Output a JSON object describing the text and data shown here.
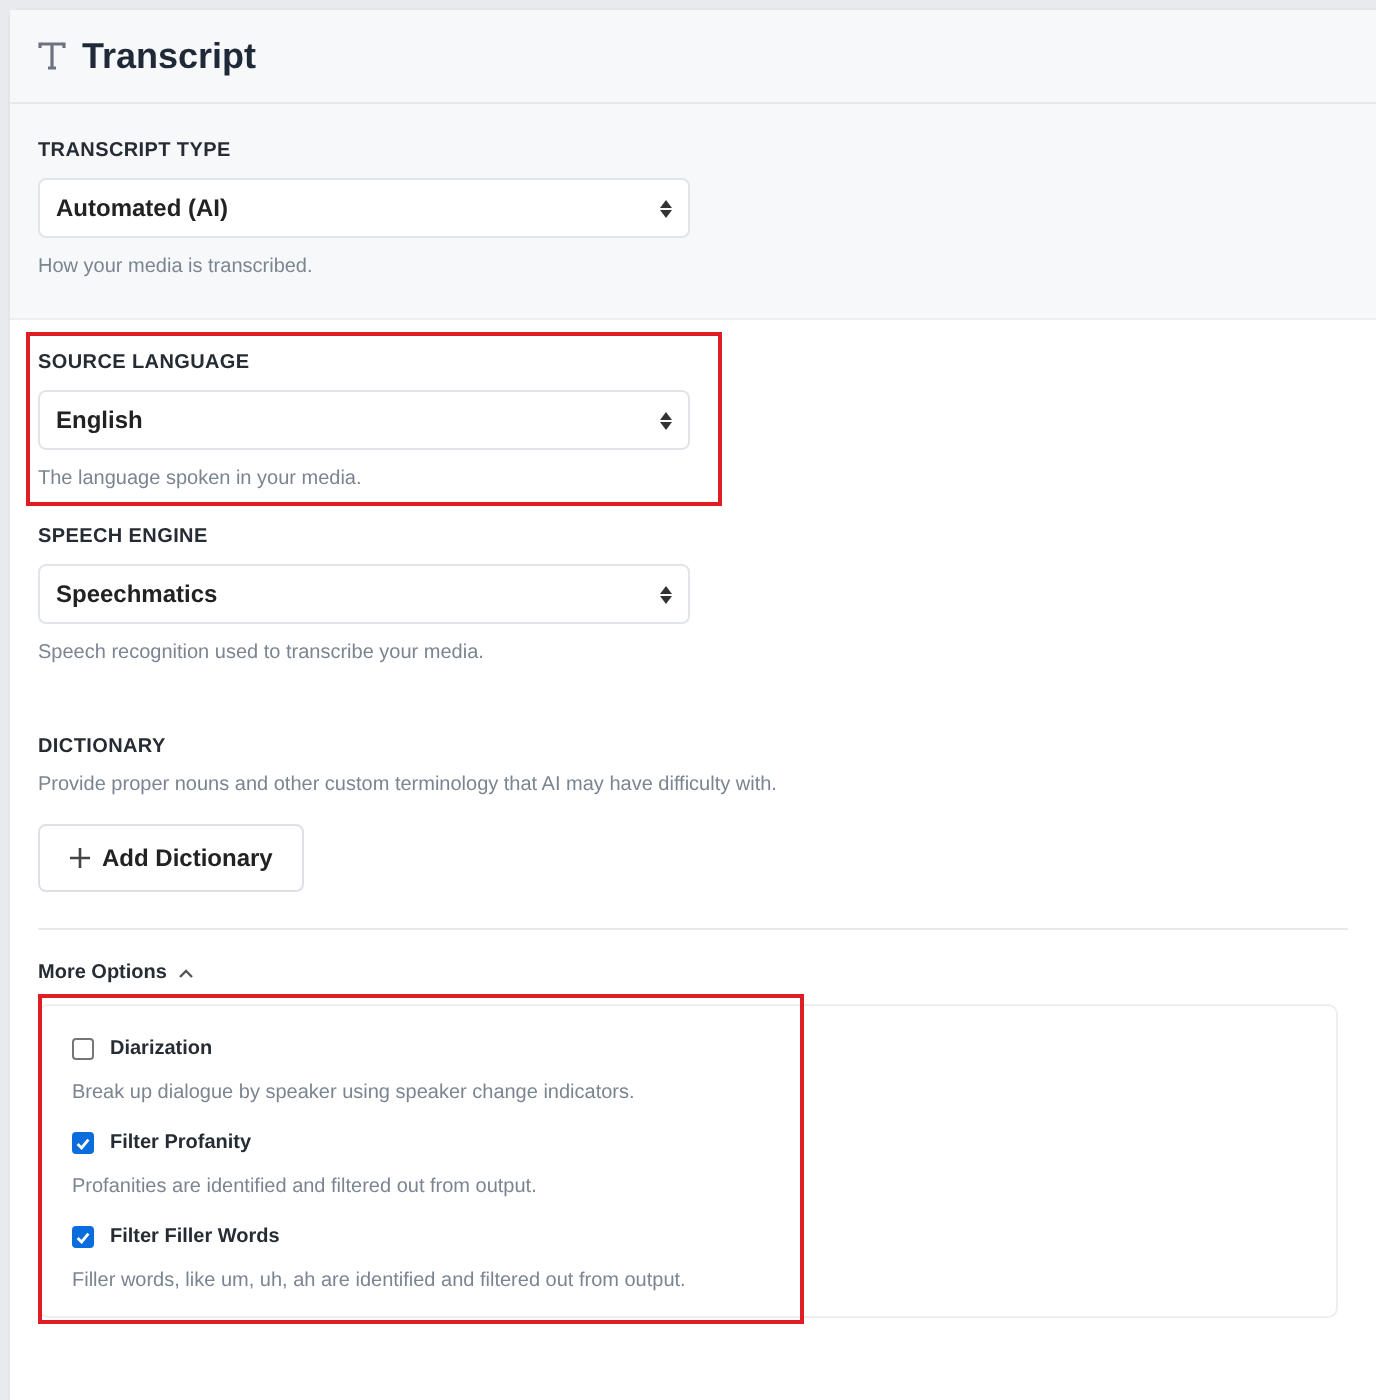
{
  "header": {
    "title": "Transcript"
  },
  "fields": [
    {
      "label": "TRANSCRIPT TYPE",
      "value": "Automated (AI)",
      "hint": "How your media is transcribed.",
      "shaded": true,
      "highlighted": false
    },
    {
      "label": "SOURCE LANGUAGE",
      "value": "English",
      "hint": "The language spoken in your media.",
      "shaded": false,
      "highlighted": true
    },
    {
      "label": "SPEECH ENGINE",
      "value": "Speechmatics",
      "hint": "Speech recognition used to transcribe your media.",
      "shaded": false,
      "highlighted": false
    }
  ],
  "dictionary": {
    "label": "DICTIONARY",
    "hint": "Provide proper nouns and other custom terminology that AI may have difficulty with.",
    "button": "Add Dictionary"
  },
  "more_options": {
    "label": "More Options",
    "expanded": true,
    "highlighted": true,
    "options": [
      {
        "label": "Diarization",
        "checked": false,
        "hint": "Break up dialogue by speaker using speaker change indicators."
      },
      {
        "label": "Filter Profanity",
        "checked": true,
        "hint": "Profanities are identified and filtered out from output."
      },
      {
        "label": "Filter Filler Words",
        "checked": true,
        "hint": "Filler words, like um, uh, ah are identified and filtered out from output."
      }
    ]
  }
}
